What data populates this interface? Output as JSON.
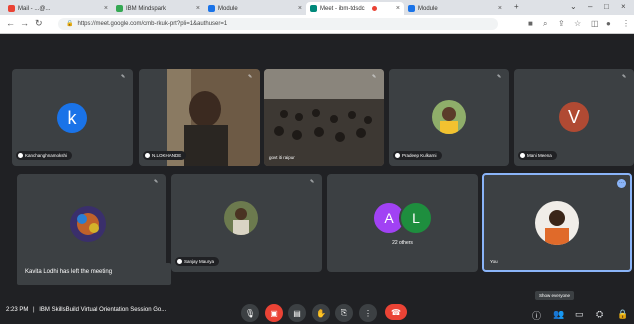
{
  "browser": {
    "tabs": [
      {
        "label": "Mail - ...@...",
        "color": "#ea4335"
      },
      {
        "label": "IBM Mindspark",
        "color": "#34a853"
      },
      {
        "label": "Module",
        "color": "#1a73e8"
      },
      {
        "label": "Meet - ibm-tdsdc",
        "color": "#00897b"
      },
      {
        "label": "Module",
        "color": "#1a73e8"
      }
    ],
    "url": "https://meet.google.com/cmb-rkuk-prt?pli=1&authuser=1"
  },
  "tiles": [
    {
      "name": "Kanchanghnamokshi",
      "initial": "k",
      "avatar_color": "#1a73e8"
    },
    {
      "name": "N.LOKHANDE"
    },
    {
      "name": "govt iti raipur"
    },
    {
      "name": "Pradeep Kulkarni"
    },
    {
      "name": "Mani Meena",
      "initial": "V",
      "avatar_color": "#b04a33"
    },
    {
      "name": "..."
    },
    {
      "name": "Sanjay Maurya"
    },
    {
      "others_label": "22 others",
      "initial_a": "A",
      "initial_b": "L",
      "color_a": "#a142f4",
      "color_b": "#1e8e3e"
    },
    {
      "name": "You"
    }
  ],
  "toast": "Kavita Lodhi has left the meeting",
  "bottom": {
    "time": "2:23 PM",
    "separator": "|",
    "meeting_title": "IBM SkillsBuild Virtual Orientation Session Go...",
    "tooltip": "Show everyone"
  }
}
